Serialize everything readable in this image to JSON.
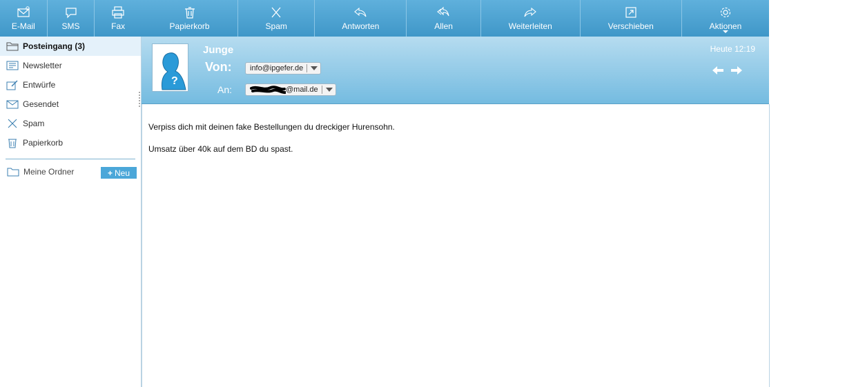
{
  "leftnav": {
    "items": [
      {
        "label": "E-Mail",
        "icon": "email-icon"
      },
      {
        "label": "SMS",
        "icon": "sms-icon"
      },
      {
        "label": "Fax",
        "icon": "fax-icon"
      }
    ]
  },
  "toolbar": {
    "items": [
      {
        "label": "Papierkorb",
        "icon": "trash-icon"
      },
      {
        "label": "Spam",
        "icon": "spam-icon"
      },
      {
        "label": "Antworten",
        "icon": "reply-icon"
      },
      {
        "label": "Allen",
        "icon": "reply-all-icon"
      },
      {
        "label": "Weiterleiten",
        "icon": "forward-icon"
      },
      {
        "label": "Verschieben",
        "icon": "move-icon"
      },
      {
        "label": "Aktionen",
        "icon": "gear-icon"
      }
    ]
  },
  "sidebar": {
    "folders": [
      {
        "label": "Posteingang (3)",
        "icon": "inbox-folder-icon"
      },
      {
        "label": "Newsletter",
        "icon": "newsletter-icon"
      },
      {
        "label": "Entwürfe",
        "icon": "drafts-icon"
      },
      {
        "label": "Gesendet",
        "icon": "sent-icon"
      },
      {
        "label": "Spam",
        "icon": "spam-icon"
      },
      {
        "label": "Papierkorb",
        "icon": "trash-icon"
      }
    ],
    "my_folders_label": "Meine Ordner",
    "new_button_label": "Neu"
  },
  "message": {
    "sender_name": "Junge",
    "from_label": "Von:",
    "from_address": "info@ipgefer.de",
    "to_label": "An:",
    "to_address": "@mail.de",
    "date": "Heute 12:19",
    "body_lines": [
      "Verpiss dich mit deinen fake Bestellungen du dreckiger Hurensohn.",
      "Umsatz über 40k auf dem BD du spast."
    ]
  },
  "colors": {
    "toolbar_blue": "#4ba7d9",
    "header_blue": "#74bbe0",
    "active_folder_bg": "#e4f1fa"
  }
}
